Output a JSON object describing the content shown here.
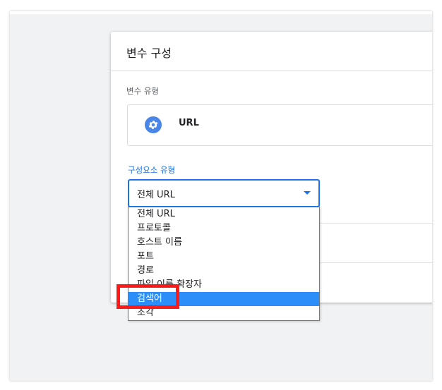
{
  "dialog": {
    "title": "변수 구성",
    "variable_type_label": "변수 유형",
    "variable_type_value": "URL",
    "component_type_label": "구성요소 유형",
    "component_type_selected": "전체 URL"
  },
  "dropdown": {
    "options": [
      "전체 URL",
      "프로토콜",
      "호스트 이름",
      "포트",
      "경로",
      "파일 이름 확장자",
      "검색어",
      "조각"
    ],
    "highlighted_index": 6
  },
  "colors": {
    "accent": "#1a73e8",
    "icon_bg": "#4a86e8",
    "selection": "#2c8ef8",
    "annotation": "#ff1a1a"
  },
  "icons": {
    "type_icon": "gear-icon",
    "select_arrow": "caret-down-icon"
  }
}
